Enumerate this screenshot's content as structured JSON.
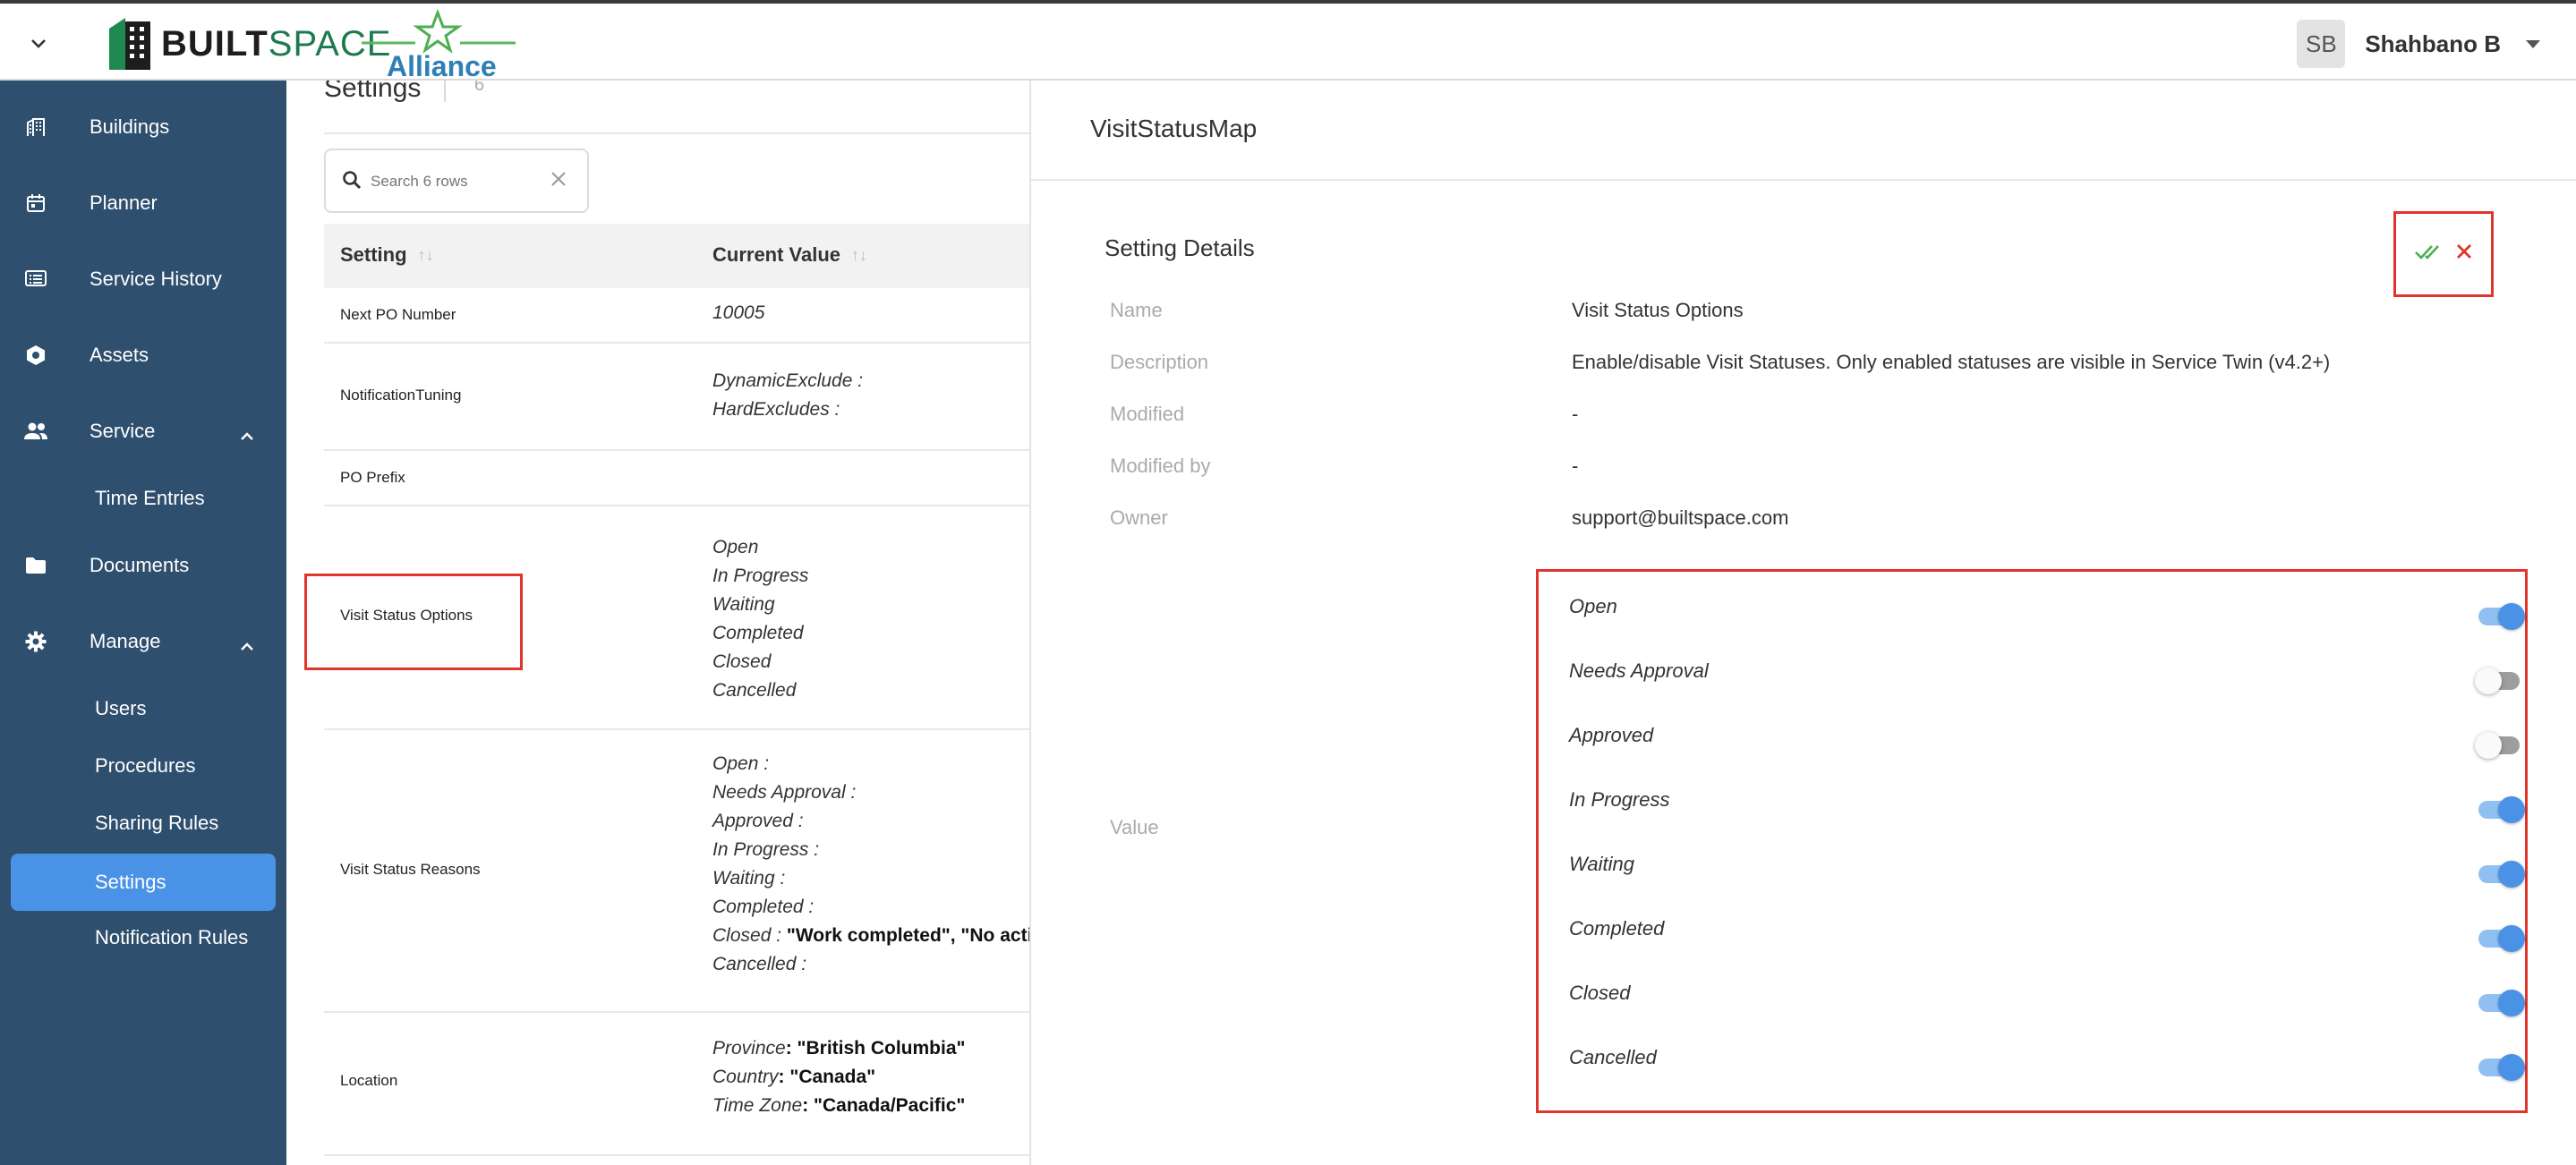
{
  "brand": {
    "logo_word": "BUILT",
    "logo_word2": "SPACE",
    "alliance_label": "Alliance"
  },
  "user": {
    "initials": "SB",
    "name": "Shahbano B"
  },
  "sidebar": {
    "items": [
      {
        "label": "Buildings",
        "icon": "building-icon"
      },
      {
        "label": "Planner",
        "icon": "calendar-icon"
      },
      {
        "label": "Service History",
        "icon": "list-icon"
      },
      {
        "label": "Assets",
        "icon": "hexagon-icon"
      },
      {
        "label": "Service",
        "icon": "people-icon"
      },
      {
        "label": "Time Entries"
      },
      {
        "label": "Documents",
        "icon": "folder-icon"
      },
      {
        "label": "Manage",
        "icon": "gear-icon"
      },
      {
        "label": "Users"
      },
      {
        "label": "Procedures"
      },
      {
        "label": "Sharing Rules"
      },
      {
        "label": "Settings"
      },
      {
        "label": "Notification Rules"
      }
    ]
  },
  "table": {
    "title": "Settings",
    "count": "6",
    "search_placeholder": "Search 6 rows",
    "col_setting": "Setting",
    "col_value": "Current Value",
    "rows": [
      {
        "setting": "Next PO Number",
        "value_lines": [
          "10005"
        ]
      },
      {
        "setting": "NotificationTuning",
        "value_lines": [
          "DynamicExclude :",
          "HardExcludes :"
        ]
      },
      {
        "setting": "PO Prefix",
        "value_lines": []
      },
      {
        "setting": "Visit Status Options",
        "value_lines": [
          "Open",
          "In Progress",
          "Waiting",
          "Completed",
          "Closed",
          "Cancelled"
        ]
      },
      {
        "setting": "Visit Status Reasons",
        "value_lines": [
          "Open :",
          "Needs Approval :",
          "Approved :",
          "In Progress :",
          "Waiting :",
          "Completed :",
          "Closed : ",
          "Cancelled :"
        ],
        "closed_bold": "\"Work completed\", \"No acti"
      },
      {
        "setting": "Location",
        "value_pairs": [
          {
            "k": "Province",
            "v": ": \"British Columbia\""
          },
          {
            "k": "Country",
            "v": ": \"Canada\""
          },
          {
            "k": "Time Zone",
            "v": ": \"Canada/Pacific\""
          }
        ]
      }
    ]
  },
  "detail": {
    "title": "VisitStatusMap",
    "section_title": "Setting Details",
    "fields": [
      {
        "label": "Name",
        "value": "Visit Status Options"
      },
      {
        "label": "Description",
        "value": "Enable/disable Visit Statuses. Only enabled statuses are visible in Service Twin (v4.2+)"
      },
      {
        "label": "Modified",
        "value": "-"
      },
      {
        "label": "Modified by",
        "value": "-"
      },
      {
        "label": "Owner",
        "value": "support@builtspace.com"
      }
    ],
    "value_label": "Value",
    "statuses": [
      {
        "label": "Open",
        "enabled": true
      },
      {
        "label": "Needs Approval",
        "enabled": false
      },
      {
        "label": "Approved",
        "enabled": false
      },
      {
        "label": "In Progress",
        "enabled": true
      },
      {
        "label": "Waiting",
        "enabled": true
      },
      {
        "label": "Completed",
        "enabled": true
      },
      {
        "label": "Closed",
        "enabled": true
      },
      {
        "label": "Cancelled",
        "enabled": true
      }
    ]
  },
  "colors": {
    "sidebar_bg": "#2e4f6e",
    "active_bg": "#4a92e6",
    "annotation_red": "#e0352b",
    "confirm_green": "#4caf50"
  }
}
